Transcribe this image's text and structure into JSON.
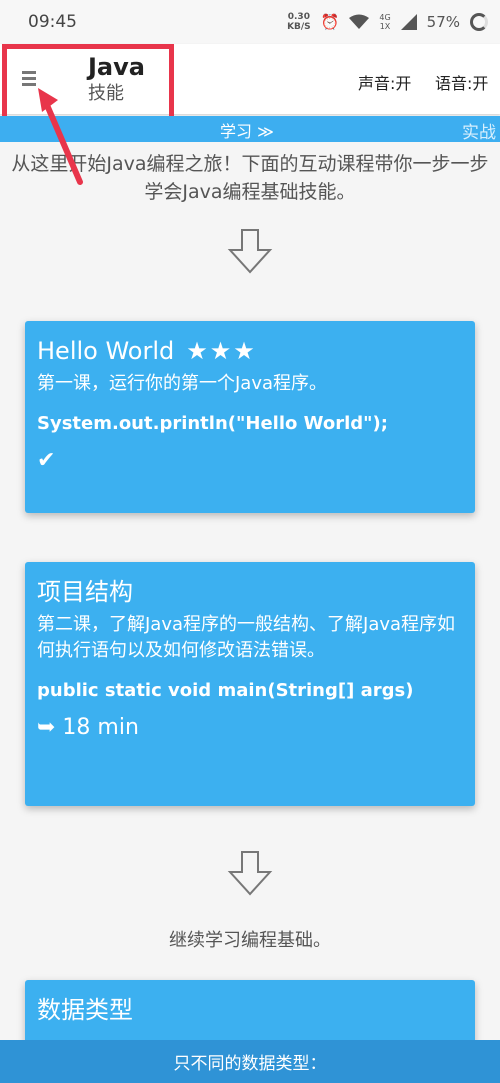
{
  "status_bar": {
    "time": "09:45",
    "net_speed_value": "0.30",
    "net_speed_unit": "KB/S",
    "network_type": "4G",
    "sim_slot": "1X",
    "battery": "57%"
  },
  "header": {
    "title": "Java",
    "subtitle": "技能",
    "sound_toggle": "声音:开",
    "voice_toggle": "语音:开"
  },
  "tabs": {
    "learn": "学习 ≫",
    "practice": "实战"
  },
  "intro_text": "从这里开始Java编程之旅！下面的互动课程带你一步一步学会Java编程基础技能。",
  "lessons": [
    {
      "title": "Hello World",
      "stars": "★★★",
      "description": "第一课，运行你的第一个Java程序。",
      "code": "System.out.println(\"Hello World\");",
      "footer": "✔"
    },
    {
      "title": "项目结构",
      "description": "第二课，了解Java程序的一般结构、了解Java程序如何执行语句以及如何修改语法错误。",
      "code": "public static void main(String[] args)",
      "footer": "➥ 18 min"
    },
    {
      "title": "数据类型"
    }
  ],
  "continue_text": "继续学习编程基础。",
  "bottom_banner": "只不同的数据类型：",
  "colors": {
    "accent": "#3cb0f0",
    "highlight": "#e8354b"
  }
}
